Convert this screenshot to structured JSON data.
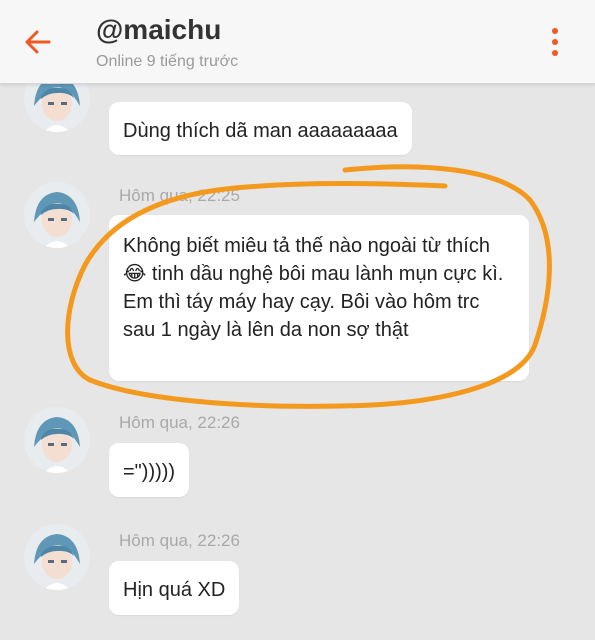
{
  "header": {
    "title": "@maichu",
    "status": "Online 9 tiếng trước",
    "accent_color": "#f05a22",
    "back_icon": "arrow-left-icon",
    "menu_icon": "more-vertical-icon"
  },
  "messages": [
    {
      "time": "",
      "text": "Dùng thích dã man aaaaaaaaa"
    },
    {
      "time": "Hôm qua, 22:25",
      "text": "Không biết miêu tả thế nào ngoài từ thích 😂 tinh dầu nghệ bôi mau lành mụn cực kì. Em thì táy máy hay cạy. Bôi vào hôm trc sau 1 ngày là lên da non sợ thật"
    },
    {
      "time": "Hôm qua, 22:26",
      "text": "=\")))))"
    },
    {
      "time": "Hôm qua, 22:26",
      "text": "Hịn quá XD"
    }
  ],
  "annotation": {
    "color": "#f39a1e",
    "shape": "hand-drawn-circle"
  }
}
